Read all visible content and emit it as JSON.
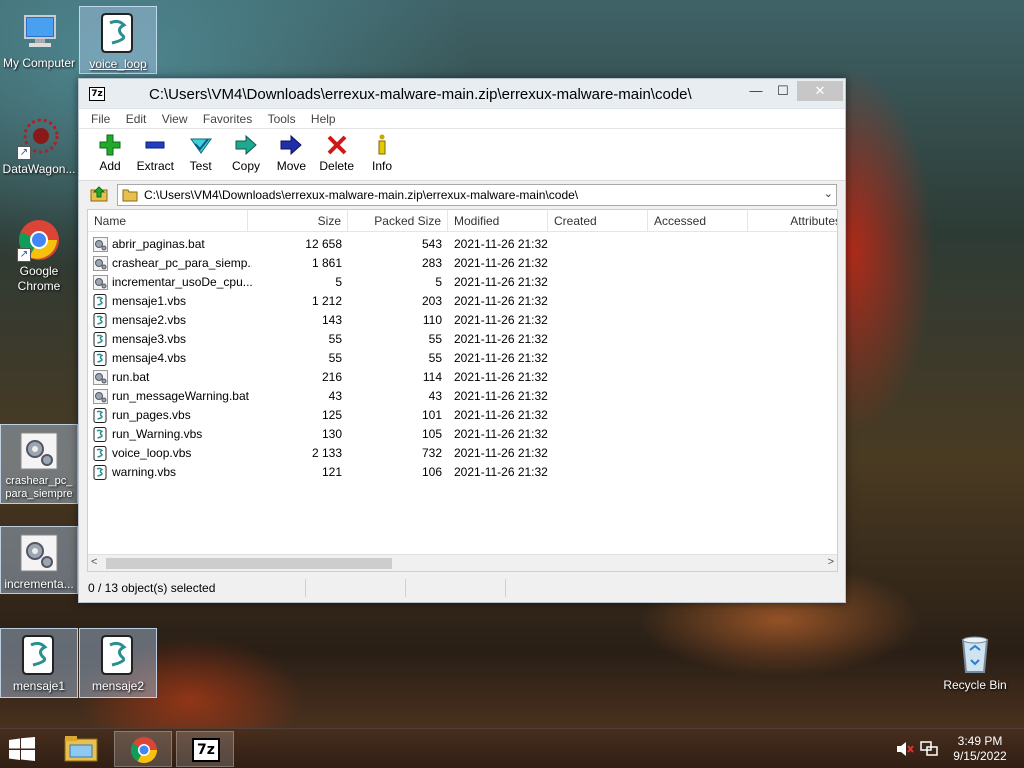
{
  "desktop": {
    "icons": [
      {
        "label": "My Computer"
      },
      {
        "label": "voice_loop"
      },
      {
        "label": "DataWagon..."
      },
      {
        "label": "Google Chrome"
      },
      {
        "label": "crashear_pc_para_siempre"
      },
      {
        "label": "incrementa..."
      },
      {
        "label": "mensaje1"
      },
      {
        "label": "mensaje2"
      },
      {
        "label": "Recycle Bin"
      }
    ]
  },
  "window": {
    "title": "C:\\Users\\VM4\\Downloads\\errexux-malware-main.zip\\errexux-malware-main\\code\\",
    "app_icon_text": "7z",
    "menu": [
      "File",
      "Edit",
      "View",
      "Favorites",
      "Tools",
      "Help"
    ],
    "toolbar": [
      "Add",
      "Extract",
      "Test",
      "Copy",
      "Move",
      "Delete",
      "Info"
    ],
    "address": "C:\\Users\\VM4\\Downloads\\errexux-malware-main.zip\\errexux-malware-main\\code\\",
    "columns": [
      "Name",
      "Size",
      "Packed Size",
      "Modified",
      "Created",
      "Accessed",
      "Attributes"
    ],
    "files": [
      {
        "name": "abrir_paginas.bat",
        "size": "12 658",
        "packed": "543",
        "modified": "2021-11-26 21:32",
        "icon": "gear"
      },
      {
        "name": "crashear_pc_para_siemp...",
        "size": "1 861",
        "packed": "283",
        "modified": "2021-11-26 21:32",
        "icon": "gear"
      },
      {
        "name": "incrementar_usoDe_cpu...",
        "size": "5",
        "packed": "5",
        "modified": "2021-11-26 21:32",
        "icon": "gear"
      },
      {
        "name": "mensaje1.vbs",
        "size": "1 212",
        "packed": "203",
        "modified": "2021-11-26 21:32",
        "icon": "script"
      },
      {
        "name": "mensaje2.vbs",
        "size": "143",
        "packed": "110",
        "modified": "2021-11-26 21:32",
        "icon": "script"
      },
      {
        "name": "mensaje3.vbs",
        "size": "55",
        "packed": "55",
        "modified": "2021-11-26 21:32",
        "icon": "script"
      },
      {
        "name": "mensaje4.vbs",
        "size": "55",
        "packed": "55",
        "modified": "2021-11-26 21:32",
        "icon": "script"
      },
      {
        "name": "run.bat",
        "size": "216",
        "packed": "114",
        "modified": "2021-11-26 21:32",
        "icon": "gear"
      },
      {
        "name": "run_messageWarning.bat",
        "size": "43",
        "packed": "43",
        "modified": "2021-11-26 21:32",
        "icon": "gear"
      },
      {
        "name": "run_pages.vbs",
        "size": "125",
        "packed": "101",
        "modified": "2021-11-26 21:32",
        "icon": "script"
      },
      {
        "name": "run_Warning.vbs",
        "size": "130",
        "packed": "105",
        "modified": "2021-11-26 21:32",
        "icon": "script"
      },
      {
        "name": "voice_loop.vbs",
        "size": "2 133",
        "packed": "732",
        "modified": "2021-11-26 21:32",
        "icon": "script"
      },
      {
        "name": "warning.vbs",
        "size": "121",
        "packed": "106",
        "modified": "2021-11-26 21:32",
        "icon": "script"
      }
    ],
    "status": "0 / 13 object(s) selected"
  },
  "taskbar": {
    "pinned_7zip_text": "7z",
    "time": "3:49 PM",
    "date": "9/15/2022"
  }
}
